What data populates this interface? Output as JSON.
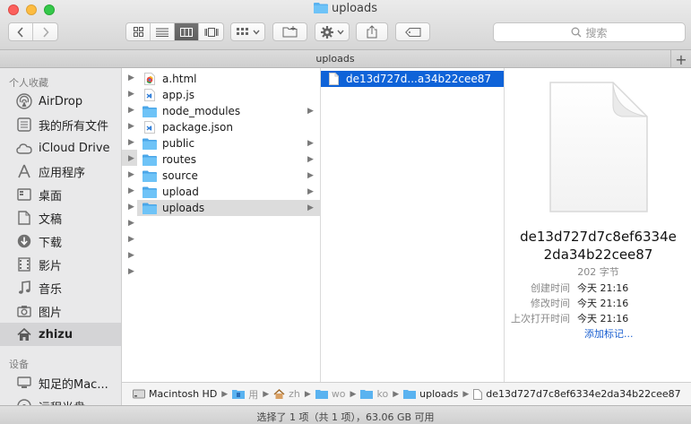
{
  "window": {
    "title": "uploads",
    "tab_label": "uploads",
    "new_tab_symbol": "+"
  },
  "toolbar": {
    "search_placeholder": "搜索",
    "view_modes": [
      "icon-view",
      "list-view",
      "column-view",
      "coverflow-view"
    ],
    "active_view": "column-view"
  },
  "sidebar": {
    "favorites_header": "个人收藏",
    "devices_header": "设备",
    "items": [
      {
        "label": "AirDrop",
        "icon": "airdrop-icon"
      },
      {
        "label": "我的所有文件",
        "icon": "all-files-icon"
      },
      {
        "label": "iCloud Drive",
        "icon": "cloud-icon"
      },
      {
        "label": "应用程序",
        "icon": "applications-icon"
      },
      {
        "label": "桌面",
        "icon": "desktop-icon"
      },
      {
        "label": "文稿",
        "icon": "documents-icon"
      },
      {
        "label": "下载",
        "icon": "download-icon"
      },
      {
        "label": "影片",
        "icon": "movies-icon"
      },
      {
        "label": "音乐",
        "icon": "music-icon"
      },
      {
        "label": "图片",
        "icon": "pictures-icon"
      },
      {
        "label": "zhizu",
        "icon": "home-icon"
      }
    ],
    "devices": [
      {
        "label": "知足的Mac...",
        "icon": "computer-icon"
      },
      {
        "label": "远程光盘",
        "icon": "disc-icon"
      }
    ]
  },
  "column2": {
    "items": [
      {
        "name": "a.html",
        "type": "html",
        "folder": false
      },
      {
        "name": "app.js",
        "type": "js",
        "folder": false
      },
      {
        "name": "node_modules",
        "type": "folder",
        "folder": true
      },
      {
        "name": "package.json",
        "type": "json",
        "folder": false
      },
      {
        "name": "public",
        "type": "folder",
        "folder": true
      },
      {
        "name": "routes",
        "type": "folder",
        "folder": true
      },
      {
        "name": "source",
        "type": "folder",
        "folder": true
      },
      {
        "name": "upload",
        "type": "folder",
        "folder": true
      },
      {
        "name": "uploads",
        "type": "folder",
        "folder": true
      }
    ]
  },
  "column3": {
    "items": [
      {
        "name": "de13d727d...a34b22cee87"
      }
    ]
  },
  "preview": {
    "name_line1": "de13d727d7c8ef6334e",
    "name_line2": "2da34b22cee87",
    "size": "202 字节",
    "created_label": "创建时间",
    "created_value": "今天 21:16",
    "modified_label": "修改时间",
    "modified_value": "今天 21:16",
    "opened_label": "上次打开时间",
    "opened_value": "今天 21:16",
    "add_tags": "添加标记..."
  },
  "pathbar": {
    "items": [
      {
        "label": "Macintosh HD",
        "icon": "disk-icon"
      },
      {
        "label": "用",
        "icon": "user-folder-icon"
      },
      {
        "label": "zh",
        "icon": "home-icon"
      },
      {
        "label": "wo",
        "icon": "folder-icon"
      },
      {
        "label": "ko",
        "icon": "folder-icon"
      },
      {
        "label": "uploads",
        "icon": "folder-icon"
      },
      {
        "label": "de13d727d7c8ef6334e2da34b22cee87",
        "icon": "document-icon"
      }
    ]
  },
  "status": {
    "text": "选择了 1 项（共 1 项），63.06 GB 可用"
  },
  "colors": {
    "selection": "#0f63d8",
    "folder": "#5ab3f0",
    "link": "#1a5fd0"
  }
}
